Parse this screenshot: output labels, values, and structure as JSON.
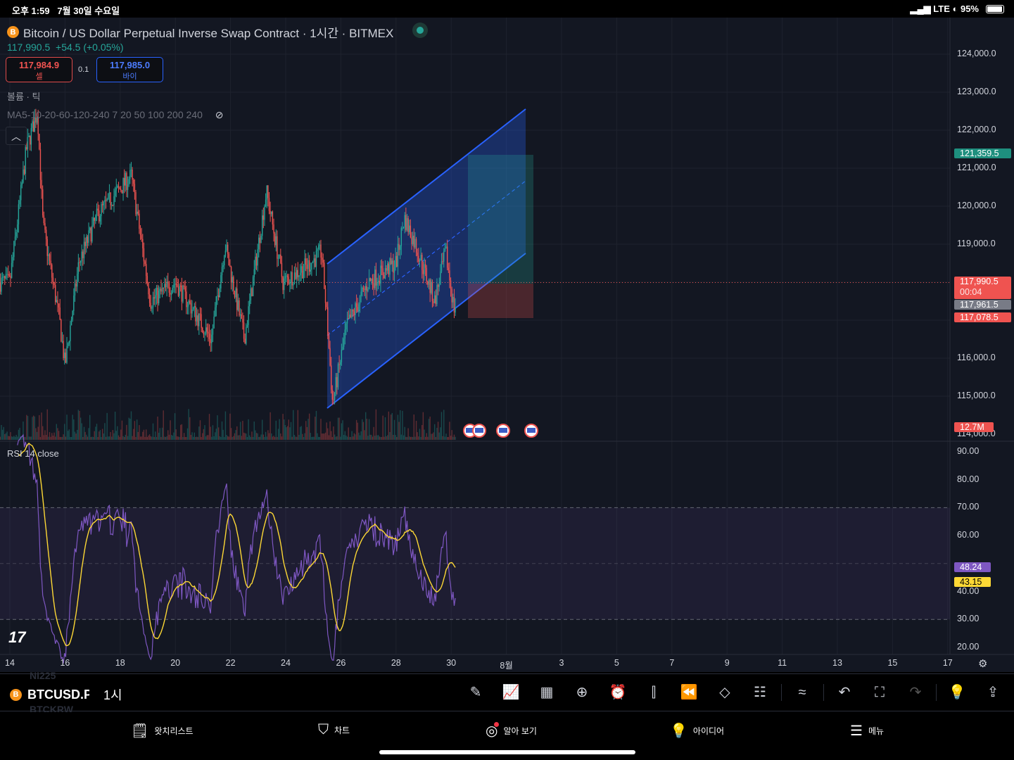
{
  "status_bar": {
    "time": "오후 1:59",
    "date": "7월 30일 수요일",
    "network": "LTE",
    "battery": "95%"
  },
  "header": {
    "title": "Bitcoin / US Dollar Perpetual Inverse Swap Contract · 1시간 · BITMEX",
    "coin_icon": "B",
    "last": "117,990.5",
    "change": "+54.5 (+0.05%)"
  },
  "trade": {
    "sell_price": "117,984.9",
    "sell_label": "셀",
    "spread": "0.1",
    "buy_price": "117,985.0",
    "buy_label": "바이"
  },
  "indicators": {
    "volume": "볼륨 · 틱",
    "ma": "MA5-10-20-60-120-240 7 20 50 100 200 240",
    "rsi": "RSI 14 close"
  },
  "price_axis": [
    "124,000.0",
    "123,000.0",
    "122,000.0",
    "121,000.0",
    "120,000.0",
    "119,000.0",
    "116,000.0",
    "115,000.0",
    "114,000.0"
  ],
  "price_tags": {
    "target": "121,359.5",
    "last": "117,990.5",
    "countdown": "00:04",
    "bid": "117,961.5",
    "stop": "117,078.5",
    "volume": "12.7M"
  },
  "rsi_axis": [
    "90.00",
    "80.00",
    "70.00",
    "60.00",
    "40.00",
    "30.00",
    "20.00"
  ],
  "rsi_tags": {
    "rsi": "48.24",
    "ma": "43.15"
  },
  "time_axis": [
    "14",
    "16",
    "18",
    "20",
    "22",
    "24",
    "26",
    "28",
    "30",
    "8월",
    "3",
    "5",
    "7",
    "9",
    "11",
    "13",
    "15",
    "17"
  ],
  "colors": {
    "up": "#26a69a",
    "down": "#ef5350",
    "channel": "#2962ff",
    "rsi": "#7e57c2",
    "rsi_ma": "#fdd835"
  },
  "price_path_days_close": [
    [
      14,
      118000
    ],
    [
      14.6,
      121500
    ],
    [
      15,
      122500
    ],
    [
      15.2,
      119500
    ],
    [
      15.8,
      117000
    ],
    [
      16,
      115800
    ],
    [
      16.5,
      118500
    ],
    [
      17.2,
      119800
    ],
    [
      18.4,
      120800
    ],
    [
      19.1,
      117500
    ],
    [
      20,
      118000
    ],
    [
      21.3,
      116500
    ],
    [
      21.8,
      119000
    ],
    [
      22.5,
      116500
    ],
    [
      23.3,
      120400
    ],
    [
      23.9,
      118000
    ],
    [
      24.9,
      118500
    ],
    [
      25.3,
      118800
    ],
    [
      25.5,
      117000
    ],
    [
      25.7,
      114800
    ],
    [
      26.2,
      116800
    ],
    [
      27,
      118000
    ],
    [
      28,
      118500
    ],
    [
      28.3,
      119700
    ],
    [
      28.7,
      119000
    ],
    [
      29.4,
      117500
    ],
    [
      29.8,
      118800
    ],
    [
      30.1,
      117300
    ],
    [
      30.5,
      118000
    ]
  ],
  "toolbar": {
    "symbol": "BTCUSD.P",
    "interval": "1시",
    "ghost_above": "NI225",
    "ghost_below": "BTCKRW"
  },
  "nav": [
    {
      "label": "왓치리스트",
      "icon": "watchlist-icon"
    },
    {
      "label": "차트",
      "icon": "chart-icon"
    },
    {
      "label": "알아 보기",
      "icon": "explore-icon"
    },
    {
      "label": "아이디어",
      "icon": "ideas-icon"
    },
    {
      "label": "메뉴",
      "icon": "menu-icon"
    }
  ]
}
